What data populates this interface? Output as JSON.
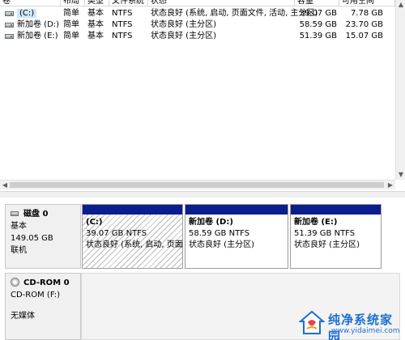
{
  "volume_list": {
    "columns": [
      "卷",
      "布局",
      "类型",
      "文件系统",
      "状态",
      "容量",
      "可用空间"
    ],
    "rows": [
      {
        "volume": "(C:)",
        "layout": "简单",
        "type": "基本",
        "fs": "NTFS",
        "status": "状态良好 (系统, 启动, 页面文件, 活动, 主分区)",
        "capacity": "39.07 GB",
        "free": "7.78 GB"
      },
      {
        "volume": "新加卷 (D:)",
        "layout": "简单",
        "type": "基本",
        "fs": "NTFS",
        "status": "状态良好 (主分区)",
        "capacity": "58.59 GB",
        "free": "23.70 GB"
      },
      {
        "volume": "新加卷 (E:)",
        "layout": "简单",
        "type": "基本",
        "fs": "NTFS",
        "status": "状态良好 (主分区)",
        "capacity": "51.39 GB",
        "free": "15.07 GB"
      }
    ]
  },
  "disk0": {
    "name": "磁盘 0",
    "type": "基本",
    "size": "149.05 GB",
    "state": "联机",
    "partitions": [
      {
        "name": "(C:)",
        "size": "39.07 GB NTFS",
        "status": "状态良好 (系统, 启动, 页面"
      },
      {
        "name": "新加卷 (D:)",
        "size": "58.59 GB NTFS",
        "status": "状态良好 (主分区)"
      },
      {
        "name": "新加卷 (E:)",
        "size": "51.39 GB NTFS",
        "status": "状态良好 (主分区)"
      }
    ]
  },
  "cdrom0": {
    "name": "CD-ROM 0",
    "drive": "CD-ROM (F:)",
    "media": "无媒体"
  },
  "watermark": {
    "title": "纯净系统家园",
    "url": "www.yidaimei.com"
  },
  "colors": {
    "partition_bar": "#0a1e8c",
    "selection": "#cce6ff",
    "watermark": "#1d6fd1"
  }
}
